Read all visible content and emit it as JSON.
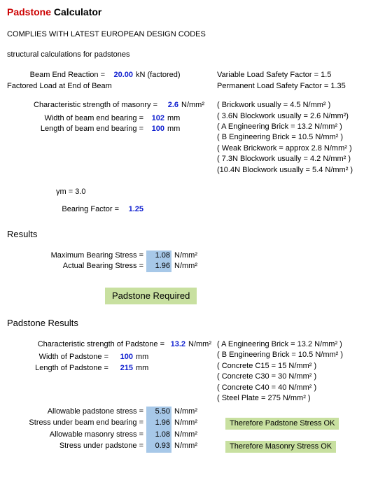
{
  "title": {
    "word1": "Padstone",
    "word2": "Calculator"
  },
  "compliance": "COMPLIES WITH LATEST EUROPEAN DESIGN CODES",
  "description": "structural calculations for padstones",
  "inputs": {
    "beam_end_reaction_label": "Beam End Reaction =",
    "beam_end_reaction_value": "20.00",
    "beam_end_reaction_unit": "kN (factored)",
    "factored_load_label": "Factored Load at End of Beam",
    "variable_sf": "Variable Load Safety Factor = 1.5",
    "permanent_sf": "Permanent Load Safety Factor = 1.35",
    "char_strength_label": "Characteristic strength of masonry =",
    "char_strength_value": "2.6",
    "char_strength_unit": "N/mm²",
    "width_bearing_label": "Width of beam end bearing =",
    "width_bearing_value": "102",
    "width_bearing_unit": "mm",
    "length_bearing_label": "Length of beam end bearing =",
    "length_bearing_value": "100",
    "length_bearing_unit": "mm",
    "masonry_notes": [
      "( Brickwork usually = 4.5 N/mm² )",
      "( 3.6N Blockwork usually = 2.6 N/mm²)",
      "( A Engineering Brick = 13.2 N/mm² )",
      "( B Engineering Brick = 10.5 N/mm² )",
      "( Weak Brickwork = approx 2.8 N/mm² )",
      "( 7.3N Blockwork usually = 4.2 N/mm² )",
      "(10.4N Blockwork usually = 5.4 N/mm² )"
    ],
    "gamma_label": "γm = 3.0",
    "bearing_factor_label": "Bearing Factor  =",
    "bearing_factor_value": "1.25"
  },
  "results": {
    "heading": "Results",
    "max_bearing_label": "Maximum Bearing Stress =",
    "max_bearing_value": "1.08",
    "actual_bearing_label": "Actual Bearing Stress =",
    "actual_bearing_value": "1.96",
    "unit": "N/mm²",
    "verdict": "Padstone Required"
  },
  "padstone": {
    "heading": "Padstone Results",
    "char_strength_label": "Characteristic strength of Padstone =",
    "char_strength_value": "13.2",
    "char_strength_unit": "N/mm²",
    "width_label": "Width of Padstone =",
    "width_value": "100",
    "width_unit": "mm",
    "length_label": "Length of Padstone =",
    "length_value": "215",
    "length_unit": "mm",
    "notes": [
      "( A Engineering Brick = 13.2 N/mm² )",
      "( B Engineering Brick = 10.5 N/mm² )",
      "( Concrete C15 = 15 N/mm² )",
      "( Concrete C30 = 30 N/mm² )",
      "( Concrete C40 = 40 N/mm² )",
      "( Steel Plate = 275 N/mm² )"
    ],
    "allow_pad_label": "Allowable padstone stress =",
    "allow_pad_value": "5.50",
    "stress_beam_label": "Stress under beam end bearing =",
    "stress_beam_value": "1.96",
    "allow_mas_label": "Allowable masonry stress =",
    "allow_mas_value": "1.08",
    "stress_pad_label": "Stress under padstone =",
    "stress_pad_value": "0.93",
    "unit": "N/mm²",
    "verdict1": "Therefore Padstone Stress OK",
    "verdict2": "Therefore Masonry Stress OK"
  }
}
